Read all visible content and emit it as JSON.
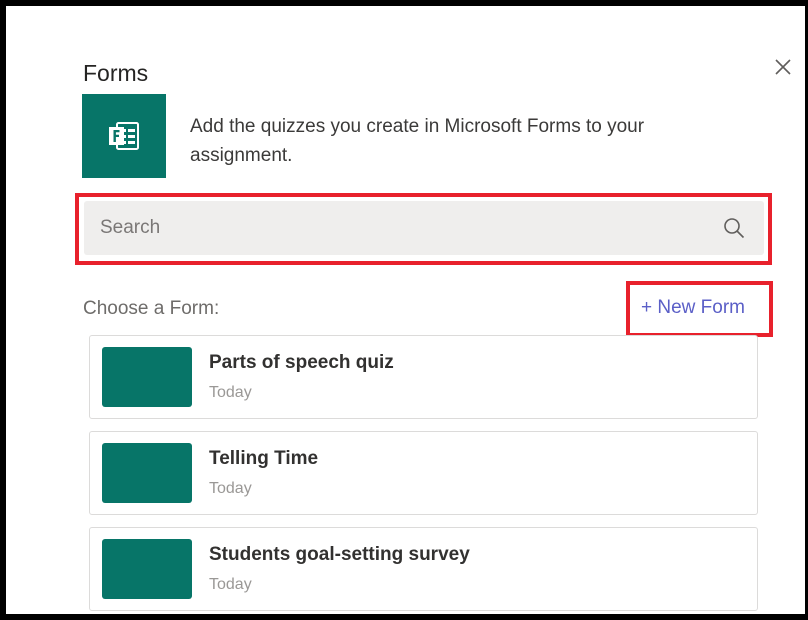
{
  "dialog": {
    "title": "Forms",
    "close_icon": "close-icon",
    "description": "Add the quizzes you create in Microsoft Forms to your assignment.",
    "logo_icon": "microsoft-forms-icon",
    "accent_color": "#077568"
  },
  "search": {
    "placeholder": "Search",
    "value": "",
    "icon": "search-icon"
  },
  "list": {
    "label": "Choose a Form:",
    "new_form_label": "+ New Form",
    "items": [
      {
        "title": "Parts of speech quiz",
        "date": "Today"
      },
      {
        "title": "Telling Time",
        "date": "Today"
      },
      {
        "title": "Students goal-setting survey",
        "date": "Today"
      }
    ]
  },
  "highlights": {
    "color": "#e8212c"
  }
}
